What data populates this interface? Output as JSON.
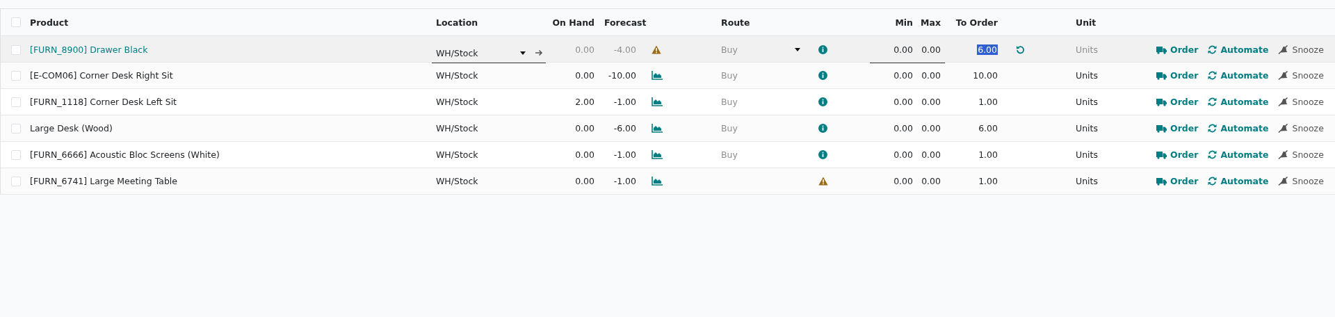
{
  "columns": {
    "product": "Product",
    "location": "Location",
    "on_hand": "On Hand",
    "forecast": "Forecast",
    "route": "Route",
    "min": "Min",
    "max": "Max",
    "to_order": "To Order",
    "unit": "Unit"
  },
  "select_all": {
    "checked": false
  },
  "rows": [
    {
      "checked": false,
      "editing": true,
      "product": "[FURN_8900] Drawer Black",
      "location": "WH/Stock",
      "on_hand": "0.00",
      "forecast": "-4.00",
      "forecast_warning": true,
      "route": "Buy",
      "route_warning": false,
      "min": "0.00",
      "max": "0.00",
      "to_order": "6.00",
      "unit": "Units",
      "actions": [
        {
          "kind": "order",
          "label": "Order"
        },
        {
          "kind": "automate",
          "label": "Automate"
        },
        {
          "kind": "snooze",
          "label": "Snooze"
        }
      ]
    },
    {
      "checked": false,
      "editing": false,
      "product": "[E-COM06] Corner Desk Right Sit",
      "location": "WH/Stock",
      "on_hand": "0.00",
      "forecast": "-10.00",
      "forecast_warning": false,
      "route": "Buy",
      "route_warning": false,
      "min": "0.00",
      "max": "0.00",
      "to_order": "10.00",
      "unit": "Units",
      "actions": [
        {
          "kind": "order",
          "label": "Order"
        },
        {
          "kind": "automate",
          "label": "Automate"
        },
        {
          "kind": "snooze",
          "label": "Snooze"
        }
      ]
    },
    {
      "checked": false,
      "editing": false,
      "product": "[FURN_1118] Corner Desk Left Sit",
      "location": "WH/Stock",
      "on_hand": "2.00",
      "forecast": "-1.00",
      "forecast_warning": false,
      "route": "Buy",
      "route_warning": false,
      "min": "0.00",
      "max": "0.00",
      "to_order": "1.00",
      "unit": "Units",
      "actions": [
        {
          "kind": "order",
          "label": "Order"
        },
        {
          "kind": "automate",
          "label": "Automate"
        },
        {
          "kind": "snooze",
          "label": "Snooze"
        }
      ]
    },
    {
      "checked": false,
      "editing": false,
      "product": "Large Desk (Wood)",
      "location": "WH/Stock",
      "on_hand": "0.00",
      "forecast": "-6.00",
      "forecast_warning": false,
      "route": "Buy",
      "route_warning": false,
      "min": "0.00",
      "max": "0.00",
      "to_order": "6.00",
      "unit": "Units",
      "actions": [
        {
          "kind": "order",
          "label": "Order"
        },
        {
          "kind": "automate",
          "label": "Automate"
        },
        {
          "kind": "snooze",
          "label": "Snooze"
        }
      ]
    },
    {
      "checked": false,
      "editing": false,
      "product": "[FURN_6666] Acoustic Bloc Screens (White)",
      "location": "WH/Stock",
      "on_hand": "0.00",
      "forecast": "-1.00",
      "forecast_warning": false,
      "route": "Buy",
      "route_warning": false,
      "min": "0.00",
      "max": "0.00",
      "to_order": "1.00",
      "unit": "Units",
      "actions": [
        {
          "kind": "order",
          "label": "Order"
        },
        {
          "kind": "automate",
          "label": "Automate"
        },
        {
          "kind": "snooze",
          "label": "Snooze"
        }
      ]
    },
    {
      "checked": false,
      "editing": false,
      "product": "[FURN_6741] Large Meeting Table",
      "location": "WH/Stock",
      "on_hand": "0.00",
      "forecast": "-1.00",
      "forecast_warning": false,
      "route_warning": true,
      "min": "0.00",
      "max": "0.00",
      "to_order": "1.00",
      "unit": "Units",
      "actions": [
        {
          "kind": "order",
          "label": "Order"
        },
        {
          "kind": "automate",
          "label": "Automate"
        },
        {
          "kind": "snooze",
          "label": "Snooze"
        }
      ]
    }
  ]
}
